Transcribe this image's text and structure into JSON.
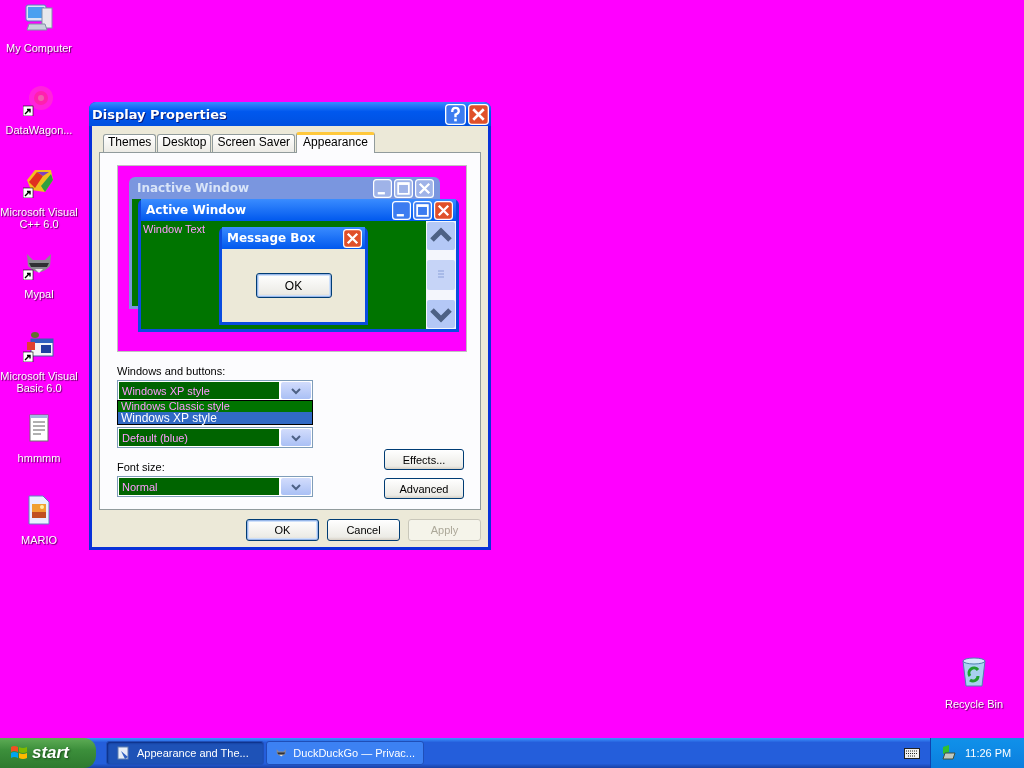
{
  "desktop_icons": [
    {
      "label": "My Computer",
      "kind": "computer",
      "shortcut": false
    },
    {
      "label": "DataWagon...",
      "kind": "swirl",
      "shortcut": true
    },
    {
      "label": "Microsoft Visual C++ 6.0",
      "kind": "tools",
      "shortcut": true
    },
    {
      "label": "Mypal",
      "kind": "animal",
      "shortcut": true
    },
    {
      "label": "Microsoft Visual Basic 6.0",
      "kind": "basic",
      "shortcut": true
    },
    {
      "label": "hmmmm",
      "kind": "notepad",
      "shortcut": false
    },
    {
      "label": "MARIO",
      "kind": "image",
      "shortcut": false
    }
  ],
  "recycle_bin": {
    "label": "Recycle Bin"
  },
  "dialog": {
    "title": "Display Properties",
    "tabs": [
      {
        "label": "Themes",
        "selected": false
      },
      {
        "label": "Desktop",
        "selected": false
      },
      {
        "label": "Screen Saver",
        "selected": false
      },
      {
        "label": "Appearance",
        "selected": true
      }
    ],
    "preview": {
      "inactive_title": "Inactive Window",
      "active_title": "Active Window",
      "window_text": "Window Text",
      "message_title": "Message Box",
      "message_button": "OK"
    },
    "windows_and_buttons": {
      "label": "Windows and buttons:",
      "value": "Windows XP style",
      "options": [
        {
          "label": "Windows Classic style",
          "selected": false
        },
        {
          "label": "Windows XP style",
          "selected": true
        }
      ]
    },
    "color_scheme": {
      "value": "Default (blue)"
    },
    "font_size": {
      "label": "Font size:",
      "value": "Normal"
    },
    "side_buttons": [
      "Effects...",
      "Advanced"
    ],
    "buttons": [
      {
        "label": "OK",
        "default": true,
        "disabled": false
      },
      {
        "label": "Cancel",
        "default": false,
        "disabled": false
      },
      {
        "label": "Apply",
        "default": false,
        "disabled": true
      }
    ]
  },
  "taskbar": {
    "start": "start",
    "tasks": [
      {
        "label": "Appearance and The...",
        "kind": "settings",
        "selected": true
      },
      {
        "label": "DuckDuckGo — Privac...",
        "kind": "animal",
        "selected": false
      }
    ],
    "clock": "11:26 PM"
  }
}
